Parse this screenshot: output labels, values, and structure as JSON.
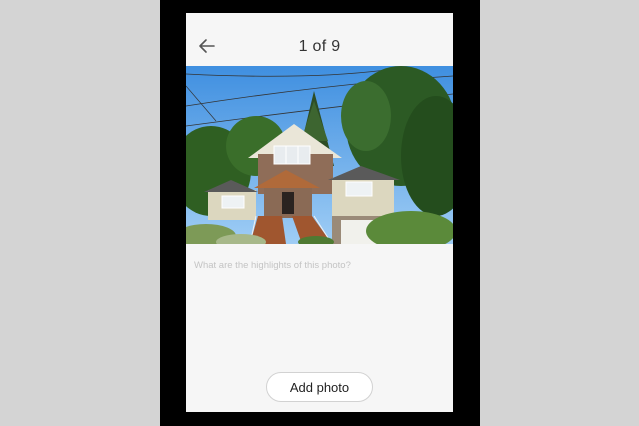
{
  "header": {
    "back_icon": "arrow-left-icon",
    "counter": "1 of 9"
  },
  "photo": {
    "subject": "house-photo"
  },
  "caption": {
    "placeholder": "What are the highlights of this photo?",
    "value": ""
  },
  "actions": {
    "add_photo_label": "Add photo"
  },
  "colors": {
    "frame": "#000000",
    "backdrop": "#d4d4d4",
    "screen": "#f6f6f6",
    "button_border": "#d2d2d2"
  }
}
